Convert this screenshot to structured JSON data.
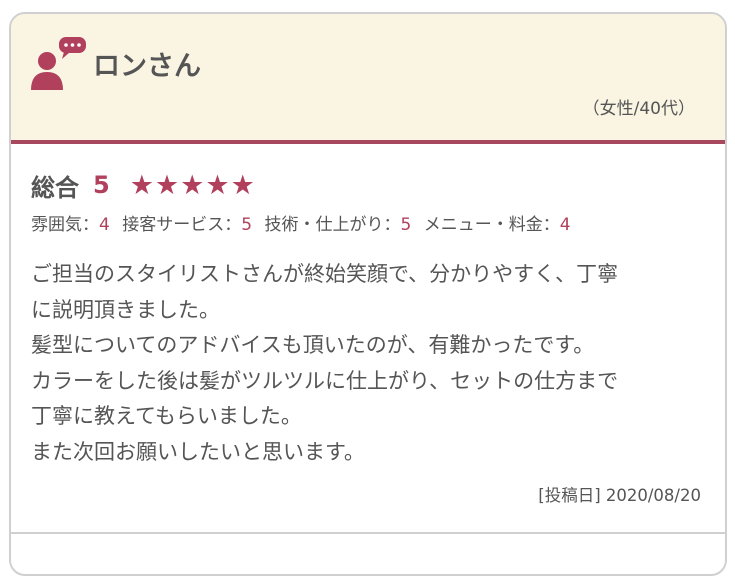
{
  "review": {
    "reviewer_name": "ロンさん",
    "reviewer_demographic": "（女性/40代）",
    "overall_label": "総合",
    "overall_score": "5",
    "stars": 5,
    "star_color": "#b0405c",
    "header_bg": "#faf4e3",
    "accent": "#a8485e",
    "sub_ratings": [
      {
        "label": "雰囲気：",
        "value": "4"
      },
      {
        "label": "接客サービス：",
        "value": "5"
      },
      {
        "label": "技術・仕上がり：",
        "value": "5"
      },
      {
        "label": "メニュー・料金：",
        "value": "4"
      }
    ],
    "comment_lines": [
      "ご担当のスタイリストさんが終始笑顔で、分かりやすく、丁寧",
      "に説明頂きました。",
      "髪型についてのアドバイスも頂いたのが、有難かったです。",
      "カラーをした後は髪がツルツルに仕上がり、セットの仕方まで",
      "丁寧に教えてもらいました。",
      "また次回お願いしたいと思います。"
    ],
    "posted_date": "[投稿日] 2020/08/20"
  }
}
